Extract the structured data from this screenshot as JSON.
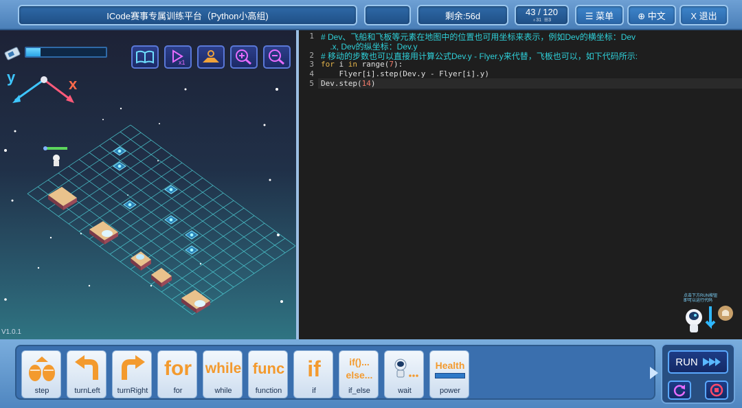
{
  "header": {
    "title": "ICode赛事专属训练平台（Python小高组)",
    "remaining": "剩余:56d",
    "progress": "43 / 120",
    "stat_likes": "31",
    "stat_list": "3",
    "menu_label": "☰ 菜单",
    "lang_label": "⊕ 中文",
    "exit_label": "X 退出"
  },
  "game": {
    "energy_level": 0.18,
    "axis_y": "y",
    "axis_x": "x",
    "version": "V1.0.1",
    "tools": [
      "book-icon",
      "speed-icon",
      "map-icon",
      "zoom-in-icon",
      "zoom-out-icon"
    ]
  },
  "editor": {
    "line_numbers": [
      "1",
      "",
      "2",
      "3",
      "4",
      "5"
    ],
    "comment1a": "# Dev、飞船和飞板等元素在地图中的位置也可用坐标来表示，例如Dev的横坐标：Dev",
    "comment1b": "    .x, Dev的纵坐标：Dev.y",
    "comment2": "# 移动的步数也可以直接用计算公式Dev.y - Flyer.y来代替，飞板也可以，如下代码所示:",
    "line3": {
      "kw_for": "for",
      "var": " i ",
      "kw_in": "in",
      "rest": " range(",
      "num": "7",
      "end": "):"
    },
    "line4": "    Flyer[i].step(Dev.y - Flyer[i].y)",
    "line5": {
      "pre": "Dev.step(",
      "num": "14",
      "end": ")"
    },
    "hint": "点击下方RUN按钮 即可以运行代码"
  },
  "palette": {
    "blocks": [
      {
        "label": "step",
        "icon": "step-icon"
      },
      {
        "label": "turnLeft",
        "icon": "turn-left-icon"
      },
      {
        "label": "turnRight",
        "icon": "turn-right-icon"
      },
      {
        "label": "for",
        "icon": "for",
        "text": "for"
      },
      {
        "label": "while",
        "icon": "while",
        "text": "while"
      },
      {
        "label": "function",
        "icon": "func",
        "text": "func"
      },
      {
        "label": "if",
        "icon": "if",
        "text": "if"
      },
      {
        "label": "if_else",
        "icon": "if-else",
        "text1": "if()...",
        "text2": "else..."
      },
      {
        "label": "wait",
        "icon": "wait-icon"
      },
      {
        "label": "power",
        "icon": "health-icon",
        "text": "Health"
      }
    ],
    "run_label": "RUN"
  }
}
